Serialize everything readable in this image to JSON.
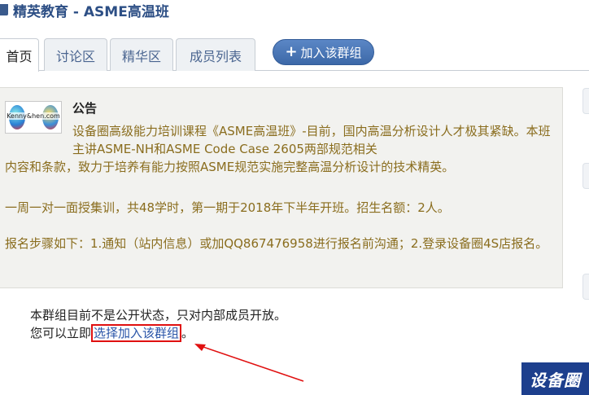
{
  "header": {
    "title": "精英教育 - ASME高温班"
  },
  "tabs": [
    {
      "label": "首页",
      "active": true
    },
    {
      "label": "讨论区",
      "active": false
    },
    {
      "label": "精华区",
      "active": false
    },
    {
      "label": "成员列表",
      "active": false
    }
  ],
  "join_button": {
    "label": "加入该群组"
  },
  "notice": {
    "logo_text": "Kenny&hen.com",
    "title": "公告",
    "paragraph_1": "设备圈高级能力培训课程《ASME高温班》-目前，国内高温分析设计人才极其紧缺。本班主讲ASME-NH和ASME Code Case 2605两部规范相关",
    "paragraph_1b": "内容和条款，致力于培养有能力按照ASME规范实施完整高温分析设计的技术精英。",
    "paragraph_2": "一周一对一面授集训，共48学时，第一期于2018年下半年开班。招生名额：2人。",
    "paragraph_3": "报名步骤如下：1.通知（站内信息）或加QQ867476958进行报名前沟通；2.登录设备圈4S店报名。"
  },
  "group_status": {
    "line_1": "本群组目前不是公开状态，只对内部成员开放。",
    "line_2_prefix": "您可以立即",
    "join_link": "选择加入该群组",
    "line_2_suffix": "。"
  },
  "watermark": "设备圈",
  "colors": {
    "accent": "#2d4f85",
    "button": "#3c68a8",
    "notice_text": "#8a6d1e",
    "highlight_box": "#e01010"
  }
}
